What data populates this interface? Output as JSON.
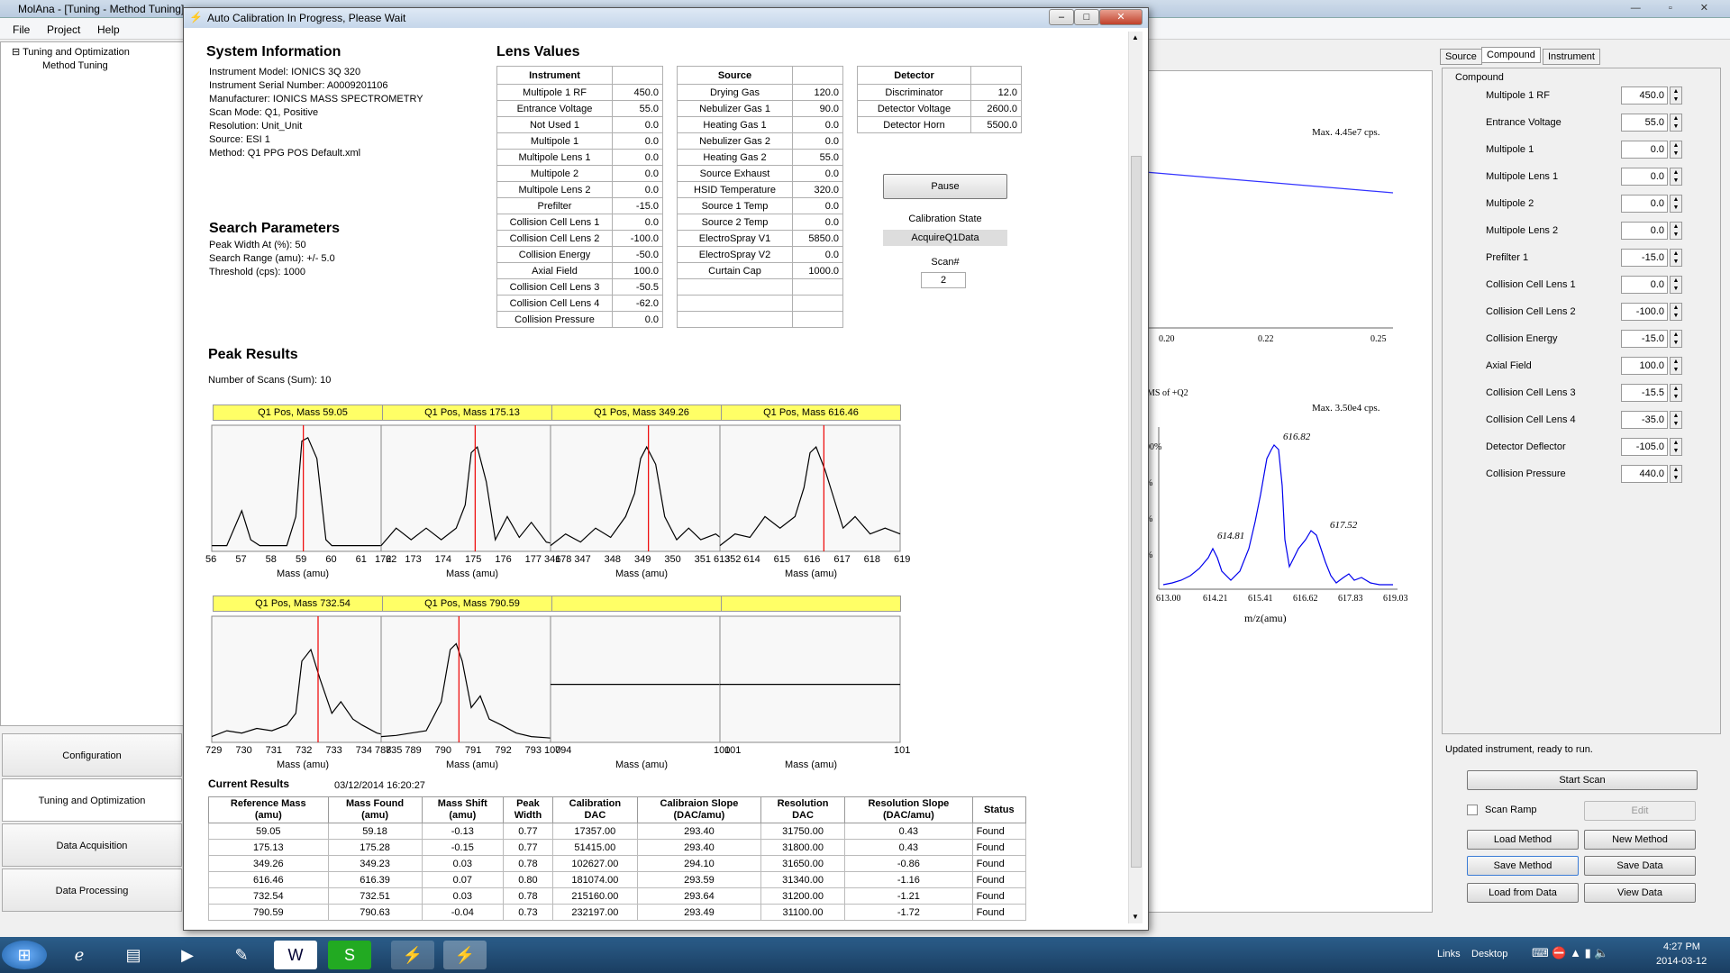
{
  "app": {
    "title": "MolAna - [Tuning - Method Tuning]",
    "menu": [
      "File",
      "Project",
      "Help"
    ]
  },
  "tree": {
    "root": "Tuning and Optimization",
    "child": "Method Tuning"
  },
  "nav": [
    "Configuration",
    "Tuning and Optimization",
    "Data Acquisition",
    "Data Processing"
  ],
  "bgplot": {
    "max1": "Max. 4.45e7 cps.",
    "xticks1": [
      "0.20",
      "0.22",
      "0.25"
    ],
    "title2": "MS of +Q2",
    "max2": "Max. 3.50e4 cps.",
    "peaks": [
      "616.82",
      "614.81",
      "617.52"
    ],
    "xticks2": [
      "613.00",
      "614.21",
      "615.41",
      "616.62",
      "617.83",
      "619.03"
    ],
    "xlabel": "m/z(amu)",
    "yticks": [
      "00%",
      "%",
      "%",
      "%"
    ]
  },
  "right": {
    "tabs": [
      "Source",
      "Compound",
      "Instrument"
    ],
    "group": "Compound",
    "params": [
      {
        "label": "Multipole 1 RF",
        "value": "450.0"
      },
      {
        "label": "Entrance Voltage",
        "value": "55.0"
      },
      {
        "label": "Multipole 1",
        "value": "0.0"
      },
      {
        "label": "Multipole Lens 1",
        "value": "0.0"
      },
      {
        "label": "Multipole 2",
        "value": "0.0"
      },
      {
        "label": "Multipole Lens 2",
        "value": "0.0"
      },
      {
        "label": "Prefilter 1",
        "value": "-15.0"
      },
      {
        "label": "Collision Cell Lens 1",
        "value": "0.0"
      },
      {
        "label": "Collision Cell Lens 2",
        "value": "-100.0"
      },
      {
        "label": "Collision Energy",
        "value": "-15.0"
      },
      {
        "label": "Axial Field",
        "value": "100.0"
      },
      {
        "label": "Collision Cell Lens 3",
        "value": "-15.5"
      },
      {
        "label": "Collision Cell Lens 4",
        "value": "-35.0"
      },
      {
        "label": "Detector Deflector",
        "value": "-105.0"
      },
      {
        "label": "Collision Pressure",
        "value": "440.0"
      }
    ],
    "status": "Updated instrument, ready to run.",
    "start_scan": "Start Scan",
    "scan_ramp": "Scan Ramp",
    "edit": "Edit",
    "load_method": "Load Method",
    "new_method": "New Method",
    "save_method": "Save Method",
    "save_data": "Save Data",
    "load_from_data": "Load from Data",
    "view_data": "View Data"
  },
  "taskbar": {
    "links": "Links",
    "desktop": "Desktop",
    "time": "4:27 PM",
    "date": "2014-03-12"
  },
  "dialog": {
    "title": "Auto Calibration In Progress, Please Wait",
    "sys_heading": "System Information",
    "sys_info": [
      "Instrument Model: IONICS 3Q 320",
      "Instrument Serial Number: A0009201106",
      "Manufacturer: IONICS MASS SPECTROMETRY",
      "Scan Mode: Q1, Positive",
      "Resolution: Unit_Unit",
      "Source: ESI 1",
      "Method: Q1 PPG POS Default.xml"
    ],
    "search_heading": "Search Parameters",
    "search_info": [
      "Peak Width At (%): 50",
      "Search Range (amu): +/- 5.0",
      "Threshold (cps): 1000"
    ],
    "lens_heading": "Lens Values",
    "instrument_header": "Instrument",
    "instrument": [
      [
        "Multipole 1 RF",
        "450.0"
      ],
      [
        "Entrance Voltage",
        "55.0"
      ],
      [
        "Not Used 1",
        "0.0"
      ],
      [
        "Multipole 1",
        "0.0"
      ],
      [
        "Multipole Lens 1",
        "0.0"
      ],
      [
        "Multipole 2",
        "0.0"
      ],
      [
        "Multipole Lens 2",
        "0.0"
      ],
      [
        "Prefilter",
        "-15.0"
      ],
      [
        "Collision Cell Lens 1",
        "0.0"
      ],
      [
        "Collision Cell Lens 2",
        "-100.0"
      ],
      [
        "Collision Energy",
        "-50.0"
      ],
      [
        "Axial Field",
        "100.0"
      ],
      [
        "Collision Cell Lens 3",
        "-50.5"
      ],
      [
        "Collision Cell Lens 4",
        "-62.0"
      ],
      [
        "Collision Pressure",
        "0.0"
      ]
    ],
    "source_header": "Source",
    "source": [
      [
        "Drying Gas",
        "120.0"
      ],
      [
        "Nebulizer Gas 1",
        "90.0"
      ],
      [
        "Heating Gas 1",
        "0.0"
      ],
      [
        "Nebulizer Gas 2",
        "0.0"
      ],
      [
        "Heating Gas 2",
        "55.0"
      ],
      [
        "Source Exhaust",
        "0.0"
      ],
      [
        "HSID Temperature",
        "320.0"
      ],
      [
        "Source 1 Temp",
        "0.0"
      ],
      [
        "Source 2 Temp",
        "0.0"
      ],
      [
        "ElectroSpray V1",
        "5850.0"
      ],
      [
        "ElectroSpray V2",
        "0.0"
      ],
      [
        "Curtain Cap",
        "1000.0"
      ],
      [
        "",
        ""
      ],
      [
        "",
        ""
      ],
      [
        "",
        ""
      ]
    ],
    "detector_header": "Detector",
    "detector": [
      [
        "Discriminator",
        "12.0"
      ],
      [
        "Detector Voltage",
        "2600.0"
      ],
      [
        "Detector Horn",
        "5500.0"
      ]
    ],
    "pause": "Pause",
    "cal_state_label": "Calibration State",
    "cal_state": "AcquireQ1Data",
    "scan_label": "Scan#",
    "scan_value": "2",
    "peak_heading": "Peak Results",
    "num_scans": "Number of Scans (Sum): 10",
    "mass_label": "Mass (amu)",
    "current_heading": "Current Results",
    "timestamp": "03/12/2014 16:20:27",
    "res_headers": [
      [
        "Reference Mass",
        "(amu)"
      ],
      [
        "Mass Found",
        "(amu)"
      ],
      [
        "Mass Shift",
        "(amu)"
      ],
      [
        "Peak",
        "Width"
      ],
      [
        "Calibration",
        "DAC"
      ],
      [
        "Calibraion Slope",
        "(DAC/amu)"
      ],
      [
        "Resolution",
        "DAC"
      ],
      [
        "Resolution Slope",
        "(DAC/amu)"
      ],
      [
        "Status",
        ""
      ]
    ],
    "results": [
      [
        "59.05",
        "59.18",
        "-0.13",
        "0.77",
        "17357.00",
        "293.40",
        "31750.00",
        "0.43",
        "Found"
      ],
      [
        "175.13",
        "175.28",
        "-0.15",
        "0.77",
        "51415.00",
        "293.40",
        "31800.00",
        "0.43",
        "Found"
      ],
      [
        "349.26",
        "349.23",
        "0.03",
        "0.78",
        "102627.00",
        "294.10",
        "31650.00",
        "-0.86",
        "Found"
      ],
      [
        "616.46",
        "616.39",
        "0.07",
        "0.80",
        "181074.00",
        "293.59",
        "31340.00",
        "-1.16",
        "Found"
      ],
      [
        "732.54",
        "732.51",
        "0.03",
        "0.78",
        "215160.00",
        "293.64",
        "31200.00",
        "-1.21",
        "Found"
      ],
      [
        "790.59",
        "790.63",
        "-0.04",
        "0.73",
        "232197.00",
        "293.49",
        "31100.00",
        "-1.72",
        "Found"
      ]
    ]
  },
  "chart_data": [
    {
      "type": "line",
      "title": "Q1 Pos, Mass 59.05",
      "xlabel": "Mass (amu)",
      "x_ticks": [
        "56",
        "57",
        "58",
        "59",
        "60",
        "61",
        "62"
      ],
      "xlim": [
        56,
        62
      ],
      "marker": 59.05,
      "x": [
        56,
        56.5,
        57,
        57.3,
        57.6,
        58,
        58.5,
        58.8,
        59,
        59.2,
        59.5,
        59.8,
        60,
        60.5,
        61,
        61.5,
        62
      ],
      "y": [
        0.05,
        0.05,
        0.35,
        0.1,
        0.05,
        0.05,
        0.05,
        0.3,
        0.95,
        0.98,
        0.8,
        0.1,
        0.05,
        0.05,
        0.05,
        0.05,
        0.05
      ]
    },
    {
      "type": "line",
      "title": "Q1 Pos, Mass 175.13",
      "xlabel": "Mass (amu)",
      "x_ticks": [
        "172",
        "173",
        "174",
        "175",
        "176",
        "177",
        "178"
      ],
      "xlim": [
        172,
        178
      ],
      "marker": 175.13,
      "x": [
        172,
        172.5,
        173,
        173.5,
        174,
        174.5,
        174.8,
        175,
        175.2,
        175.5,
        175.8,
        176.2,
        176.6,
        177,
        177.5,
        178
      ],
      "y": [
        0.05,
        0.2,
        0.1,
        0.2,
        0.1,
        0.2,
        0.4,
        0.85,
        0.9,
        0.6,
        0.1,
        0.3,
        0.12,
        0.25,
        0.08,
        0.05
      ]
    },
    {
      "type": "line",
      "title": "Q1 Pos, Mass 349.26",
      "xlabel": "Mass (amu)",
      "x_ticks": [
        "346",
        "347",
        "348",
        "349",
        "350",
        "351",
        "352"
      ],
      "xlim": [
        346,
        352
      ],
      "marker": 349.26,
      "x": [
        346,
        346.5,
        347,
        347.5,
        348,
        348.5,
        348.8,
        349,
        349.2,
        349.5,
        349.8,
        350.2,
        350.6,
        351,
        351.5,
        352
      ],
      "y": [
        0.05,
        0.15,
        0.08,
        0.2,
        0.12,
        0.3,
        0.5,
        0.8,
        0.9,
        0.75,
        0.3,
        0.1,
        0.2,
        0.1,
        0.15,
        0.05
      ]
    },
    {
      "type": "line",
      "title": "Q1 Pos, Mass 616.46",
      "xlabel": "Mass (amu)",
      "x_ticks": [
        "613",
        "614",
        "615",
        "616",
        "617",
        "618",
        "619"
      ],
      "xlim": [
        613,
        619
      ],
      "marker": 616.46,
      "x": [
        613,
        613.5,
        614,
        614.5,
        615,
        615.5,
        615.8,
        616,
        616.2,
        616.5,
        616.8,
        617.1,
        617.5,
        618,
        618.5,
        619
      ],
      "y": [
        0.05,
        0.15,
        0.12,
        0.3,
        0.2,
        0.3,
        0.55,
        0.85,
        0.9,
        0.7,
        0.45,
        0.2,
        0.3,
        0.15,
        0.2,
        0.15
      ]
    },
    {
      "type": "line",
      "title": "Q1 Pos, Mass 732.54",
      "xlabel": "Mass (amu)",
      "x_ticks": [
        "729",
        "730",
        "731",
        "732",
        "733",
        "734",
        "735"
      ],
      "xlim": [
        729,
        735
      ],
      "marker": 732.54,
      "x": [
        729,
        729.5,
        730,
        730.5,
        731,
        731.5,
        731.8,
        732,
        732.3,
        732.6,
        733,
        733.3,
        733.7,
        734,
        734.5,
        735
      ],
      "y": [
        0.05,
        0.1,
        0.08,
        0.12,
        0.1,
        0.15,
        0.25,
        0.7,
        0.8,
        0.55,
        0.25,
        0.35,
        0.2,
        0.15,
        0.08,
        0.05
      ]
    },
    {
      "type": "line",
      "title": "Q1 Pos, Mass 790.59",
      "xlabel": "Mass (amu)",
      "x_ticks": [
        "788",
        "789",
        "790",
        "791",
        "792",
        "793",
        "794"
      ],
      "xlim": [
        788,
        794
      ],
      "marker": 790.59,
      "x": [
        788,
        788.5,
        789,
        789.5,
        790,
        790.3,
        790.5,
        790.7,
        791,
        791.3,
        791.6,
        792,
        792.5,
        793,
        793.5,
        794
      ],
      "y": [
        0.05,
        0.06,
        0.08,
        0.1,
        0.35,
        0.8,
        0.85,
        0.7,
        0.3,
        0.4,
        0.2,
        0.15,
        0.08,
        0.05,
        0.04,
        0.03
      ]
    },
    {
      "type": "line",
      "title": "",
      "xlabel": "Mass (amu)",
      "x_ticks": [
        "100",
        "101"
      ],
      "xlim": [
        100,
        101
      ],
      "x": [
        100,
        101
      ],
      "y": [
        0.5,
        0.5
      ]
    },
    {
      "type": "line",
      "title": "",
      "xlabel": "Mass (amu)",
      "x_ticks": [
        "100",
        "101"
      ],
      "xlim": [
        100,
        101
      ],
      "x": [
        100,
        101
      ],
      "y": [
        0.5,
        0.5
      ]
    }
  ]
}
